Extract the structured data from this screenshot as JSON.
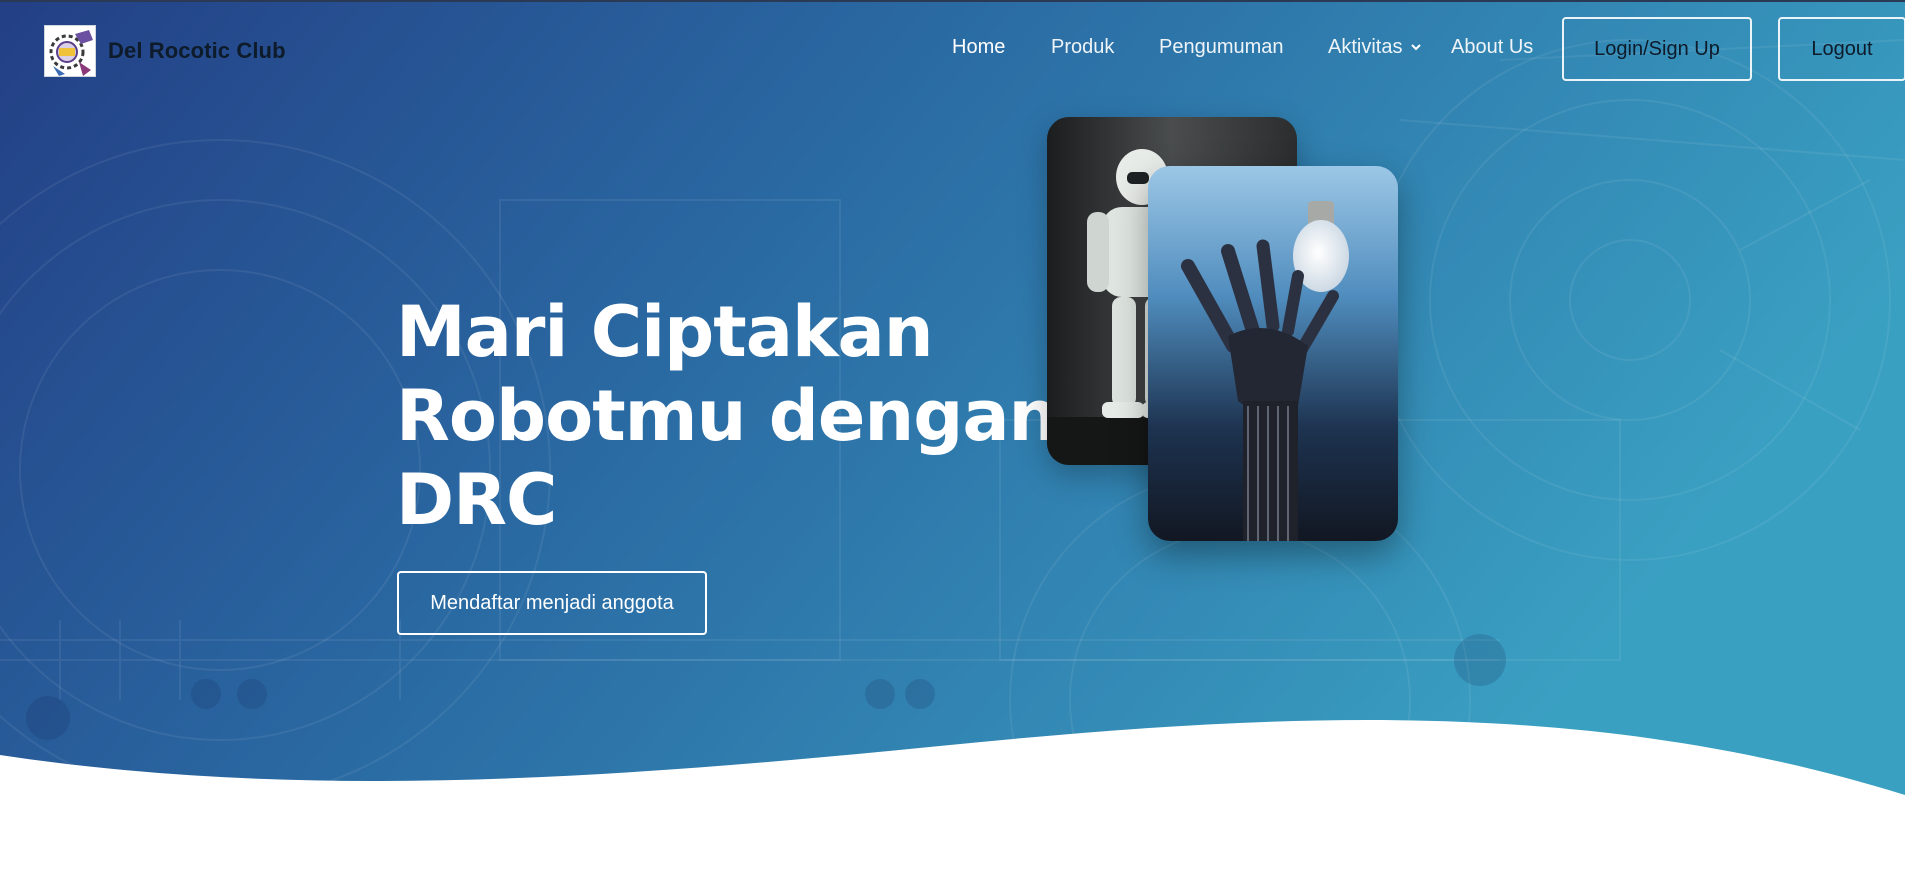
{
  "brand": {
    "name": "Del Rocotic Club",
    "logo_icon": "club-logo-icon"
  },
  "nav": {
    "items": [
      {
        "label": "Home",
        "active": true
      },
      {
        "label": "Produk",
        "active": false
      },
      {
        "label": "Pengumuman",
        "active": false
      },
      {
        "label": "Aktivitas",
        "active": false,
        "icon": "chevron-down-icon"
      },
      {
        "label": "About Us",
        "active": false
      }
    ],
    "login_label": "Login/Sign Up",
    "logout_label": "Logout"
  },
  "hero": {
    "headline_lines": [
      "Mari Ciptakan",
      "Robotmu dengan",
      "DRC"
    ],
    "cta_label": "Mendaftar menjadi anggota",
    "images": [
      {
        "name": "humanoid-robot-photo"
      },
      {
        "name": "robot-hand-lightbulb-photo"
      }
    ]
  },
  "colors": {
    "gradient_start": "#233f85",
    "gradient_mid": "#2a6aa3",
    "gradient_end": "#3aa0c2",
    "text_dark": "#0d1b2a",
    "white": "#ffffff"
  }
}
